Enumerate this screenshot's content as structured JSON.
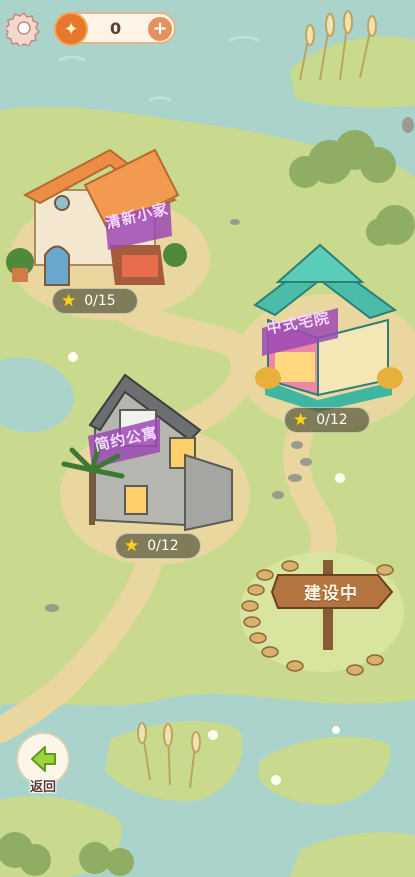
{
  "top_bar": {
    "currency_value": "0",
    "add_symbol": "+"
  },
  "buildings": [
    {
      "id": "fresh-cottage",
      "label": "清新小家",
      "progress": "0/15"
    },
    {
      "id": "chinese-courtyard",
      "label": "中式宅院",
      "progress": "0/12"
    },
    {
      "id": "simple-apartment",
      "label": "简约公寓",
      "progress": "0/12"
    }
  ],
  "construction_sign": {
    "label": "建设中"
  },
  "back_button": {
    "label": "返回"
  },
  "colors": {
    "grass": "#c7d98a",
    "water": "#a9d3cb",
    "path": "#ead7a0",
    "star": "#ffd21e",
    "label_text": "#f7d7ff"
  },
  "icons": {
    "settings": "gear-icon",
    "currency": "coin-icon",
    "add": "plus-icon",
    "star": "star-icon",
    "back": "back-arrow-icon"
  }
}
